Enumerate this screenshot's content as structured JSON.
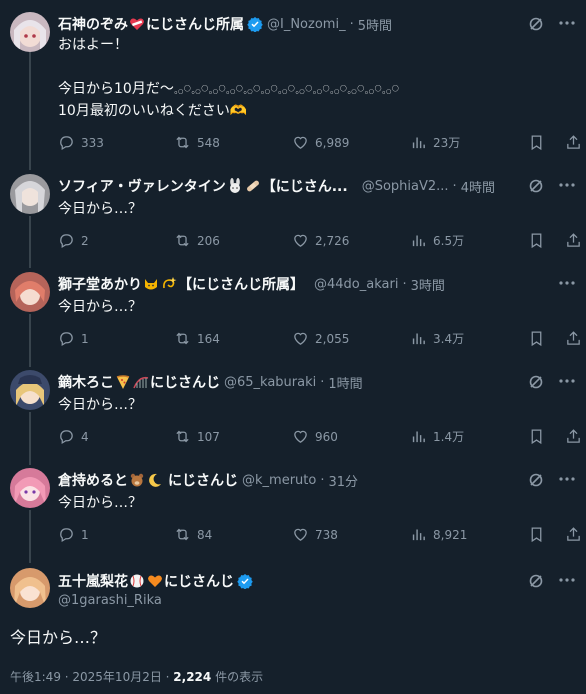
{
  "replies": [
    {
      "display_name": "石神のぞみ",
      "badges": [
        "heart-emoji"
      ],
      "name_suffix": "にじさんじ所属",
      "verified": true,
      "handle": "@I_Nozomi_",
      "time": "5時間",
      "text": "おはよー！\n\n今日から10月だ〜𓈒𓂂𓏸𓈒𓂂𓏸𓈒𓂂𓏸𓈒𓂂𓏸𓈒𓂂𓏸𓈒𓂂𓏸𓈒𓂂𓏸𓈒𓂂𓏸𓈒𓂂𓏸𓈒𓂂𓏸𓈒𓂂𓏸𓈒𓂂𓏸𓈒𓂂𓏸\n10月最初のいいねください🫶",
      "stats": {
        "replies": "333",
        "reposts": "548",
        "likes": "6,989",
        "views": "23万"
      },
      "avatar_color": "#c9b8c0"
    },
    {
      "display_name": "ソフィア・ヴァレンタイン",
      "badges": [
        "rabbit-emoji",
        "bandage-emoji"
      ],
      "name_suffix": "【にじさん...",
      "verified": false,
      "handle": "@SophiaV2...",
      "time": "4時間",
      "text": "今日から…？",
      "stats": {
        "replies": "2",
        "reposts": "206",
        "likes": "2,726",
        "views": "6.5万"
      },
      "avatar_color": "#b7b6b8"
    },
    {
      "display_name": "獅子堂あかり",
      "badges": [
        "cat-emoji",
        "dizzy-emoji"
      ],
      "name_suffix": "【にじさんじ所属】",
      "verified": false,
      "handle": "@44do_akari",
      "time": "3時間",
      "text": "今日から…？",
      "stats": {
        "replies": "1",
        "reposts": "164",
        "likes": "2,055",
        "views": "3.4万"
      },
      "avatar_color": "#d98a7a"
    },
    {
      "display_name": "鏑木ろこ",
      "badges": [
        "pizza-emoji",
        "roller-coaster-emoji"
      ],
      "name_suffix": "にじさんじ",
      "verified": false,
      "handle": "@65_kaburaki",
      "time": "1時間",
      "text": "今日から…？",
      "stats": {
        "replies": "4",
        "reposts": "107",
        "likes": "960",
        "views": "1.4万"
      },
      "avatar_color": "#e4c08a"
    },
    {
      "display_name": "倉持めると",
      "badges": [
        "bear-emoji",
        "moon-emoji"
      ],
      "name_suffix": "にじさんじ",
      "verified": false,
      "handle": "@k_meruto",
      "time": "31分",
      "text": "今日から…？",
      "stats": {
        "replies": "1",
        "reposts": "84",
        "likes": "738",
        "views": "8,921"
      },
      "avatar_color": "#e7a0b8"
    }
  ],
  "main": {
    "display_name": "五十嵐梨花",
    "badges": [
      "baseball-emoji",
      "orange-heart-emoji"
    ],
    "name_suffix": "にじさんじ",
    "verified": true,
    "handle": "@1garashi_Rika",
    "text": "今日から…？",
    "time_label": "午後1:49 · 2025年10月2日 · ",
    "views_count": "2,224",
    "views_suffix": " 件の表示",
    "avatar_color": "#e8b890"
  },
  "colors": {
    "background": "#15202b",
    "verified": "#1d9bf0",
    "muted": "#8b98a5",
    "line": "#38444d"
  }
}
